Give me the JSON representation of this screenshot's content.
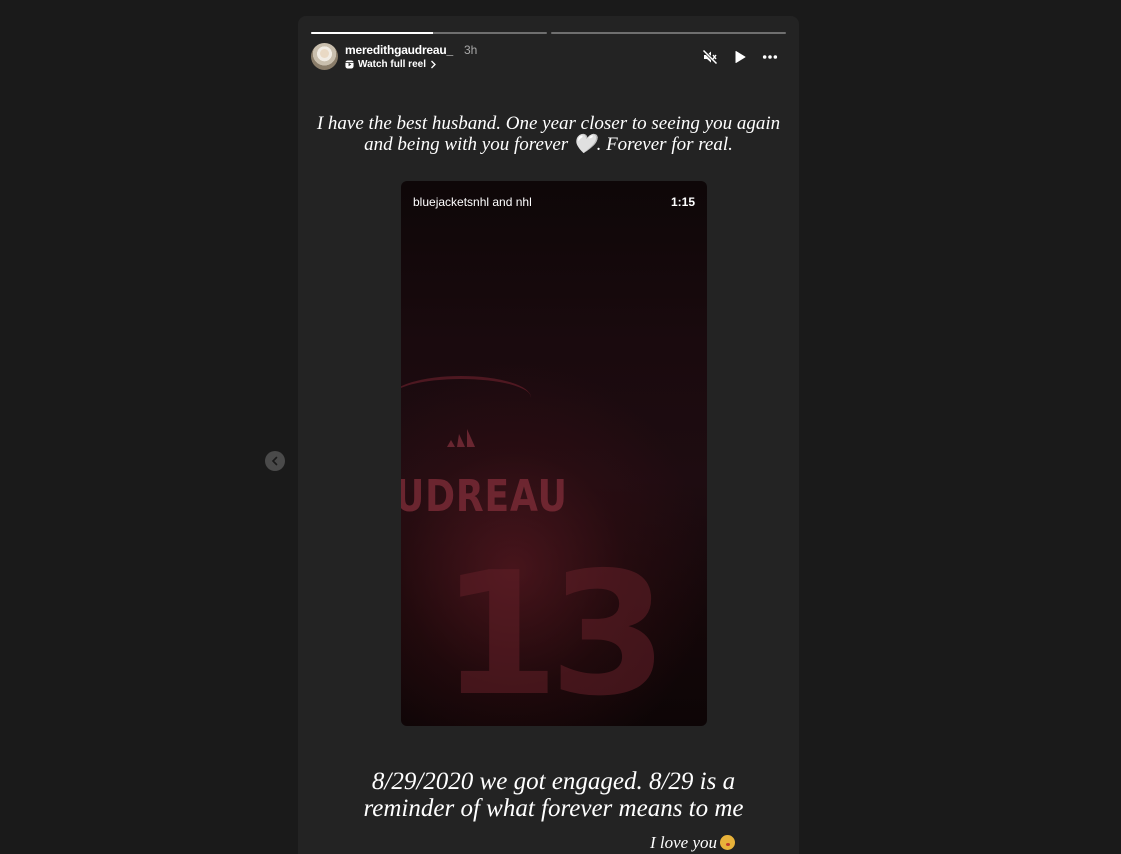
{
  "story": {
    "progress": [
      0.52,
      0.0
    ],
    "user": {
      "username": "meredithgaudreau_",
      "time": "3h",
      "watch_label": "Watch full reel"
    },
    "caption_top": "I have the best husband. One year closer to seeing you again and being with you forever",
    "caption_top_emoji": "🤍",
    "caption_top_end": ". Forever for real.",
    "reel": {
      "author": "bluejacketsnhl and nhl",
      "duration": "1:15",
      "jersey_name": "UDREAU",
      "jersey_number": "13"
    },
    "caption_bottom": "8/29/2020 we got engaged. 8/29 is a reminder of what forever means to me",
    "caption_love": "I love you"
  },
  "icons": {
    "mute": "speaker-muted-icon",
    "play": "play-icon",
    "more": "more-horizontal-icon",
    "reel": "reel-icon",
    "chevron": "chevron-right-icon",
    "prev": "chevron-left-icon"
  },
  "colors": {
    "background": "#1a1a1a",
    "story_bg": "#232323",
    "text": "#ffffff",
    "muted_text": "#a8a8a8"
  }
}
